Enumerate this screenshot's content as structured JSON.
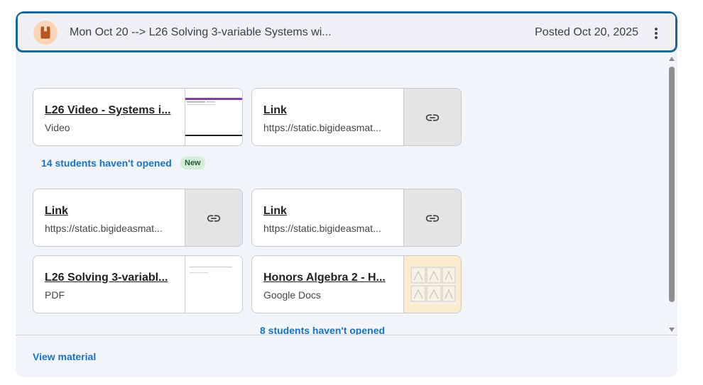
{
  "header": {
    "title": "Mon Oct 20 --> L26 Solving 3-variable Systems wi...",
    "posted": "Posted Oct 20, 2025",
    "type_icon": "bookmark-material-icon",
    "more_icon": "more-vert-icon"
  },
  "attachments": [
    {
      "title": "L26 Video - Systems i...",
      "subtitle": "Video",
      "thumb": "video-thumbnail"
    },
    {
      "title": "Link",
      "subtitle": "https://static.bigideasmat...",
      "thumb": "link-icon"
    },
    {
      "title": "Link",
      "subtitle": "https://static.bigideasmat...",
      "thumb": "link-icon"
    },
    {
      "title": "Link",
      "subtitle": "https://static.bigideasmat...",
      "thumb": "link-icon"
    },
    {
      "title": "L26 Solving 3-variabl...",
      "subtitle": "PDF",
      "thumb": "pdf-thumbnail"
    },
    {
      "title": "Honors Algebra 2 - H...",
      "subtitle": "Google Docs",
      "thumb": "docs-thumbnail"
    }
  ],
  "status": {
    "first_group": "14 students haven't opened",
    "new_badge": "New",
    "second_group": "8 students haven't opened"
  },
  "footer": {
    "view_material": "View material"
  },
  "colors": {
    "accent": "#1a73c2",
    "border_highlight": "#1a6597",
    "badge_bg": "#d3ecd9"
  }
}
